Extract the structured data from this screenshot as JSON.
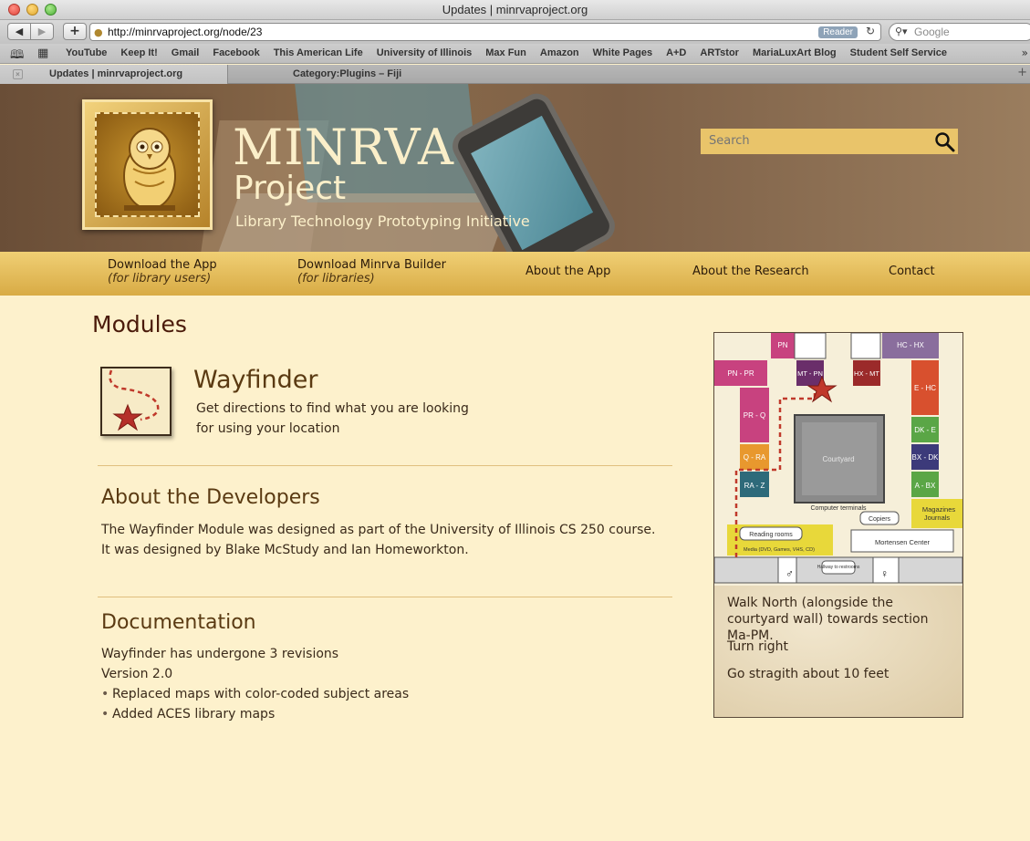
{
  "browser": {
    "window_title": "Updates | minrvaproject.org",
    "url": "http://minrvaproject.org/node/23",
    "reader_label": "Reader",
    "search_placeholder": "Google",
    "bookmarks": [
      "YouTube",
      "Keep It!",
      "Gmail",
      "Facebook",
      "This American Life",
      "University of Illinois",
      "Max Fun",
      "Amazon",
      "White Pages",
      "A+D",
      "ARTstor",
      "MariaLuxArt Blog",
      "Student Self Service"
    ],
    "tabs": [
      {
        "label": "Updates | minrvaproject.org"
      },
      {
        "label": "Category:Plugins – Fiji"
      }
    ]
  },
  "site": {
    "title": "MINRVA",
    "subtitle": "Project",
    "tagline": "Library Technology Prototyping Initiative",
    "search_placeholder": "Search"
  },
  "nav": [
    {
      "label": "Download the App",
      "sub": "(for library users)"
    },
    {
      "label": "Download Minrva Builder",
      "sub": "(for libraries)"
    },
    {
      "label": "About the App",
      "sub": ""
    },
    {
      "label": "About the Research",
      "sub": ""
    },
    {
      "label": "Contact",
      "sub": ""
    }
  ],
  "page": {
    "title": "Modules",
    "wayfinder": {
      "title": "Wayfinder",
      "description": "Get directions to find what you are looking for using your location"
    },
    "developers": {
      "title": "About the Developers",
      "body": "The Wayfinder Module was designed as part of the University of Illinois CS 250 course. It was designed by Blake McStudy and Ian Homeworkton."
    },
    "documentation": {
      "title": "Documentation",
      "lines": [
        "Wayfinder has undergone 3 revisions",
        "Version 2.0"
      ],
      "bullets": [
        "Replaced maps with color-coded subject areas",
        "Added ACES library maps"
      ]
    }
  },
  "map": {
    "sections": [
      "PN",
      "HC - HX",
      "PN - PR",
      "MT - PN",
      "HX - MT",
      "E - HC",
      "PR - Q",
      "DK - E",
      "Q - RA",
      "BX - DK",
      "RA - Z",
      "A - BX",
      "Magazines",
      "Journals"
    ],
    "labels": {
      "courtyard": "Courtyard",
      "terminals": "Computer terminals",
      "copiers": "Copiers",
      "reading": "Reading rooms",
      "media": "Media (DVD, Games, VHS, CD)",
      "mortensen": "Mortensen Center",
      "hallway": "Hallway to restrooms"
    },
    "directions": [
      "Walk North (alongside the courtyard wall) towards section Ma-PM.",
      "Turn right",
      "Go stragith about 10 feet"
    ]
  }
}
